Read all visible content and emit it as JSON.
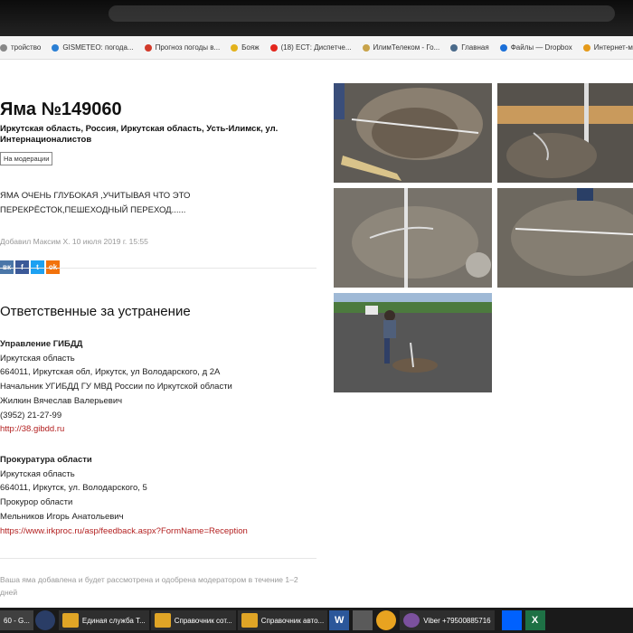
{
  "bookmarks": [
    {
      "label": "тройство",
      "color": "#888888"
    },
    {
      "label": "GISMETEO: погода...",
      "color": "#2a7fd4"
    },
    {
      "label": "Прогноз погоды в...",
      "color": "#d23a2a"
    },
    {
      "label": "Бояж",
      "color": "#e3b21c"
    },
    {
      "label": "(18) ЕСТ: Диспетче...",
      "color": "#e3261c"
    },
    {
      "label": "ИлимТелеком - Го...",
      "color": "#c8a34a"
    },
    {
      "label": "Главная",
      "color": "#4a6a8a"
    },
    {
      "label": "Файлы — Dropbox",
      "color": "#1a6fd8"
    },
    {
      "label": "Интернет-магаз...",
      "color": "#e59a1a"
    }
  ],
  "page": {
    "title": "Яма №149060",
    "address": "Иркутская область, Россия, Иркутская область, Усть-Илимск, ул. Интернационалистов",
    "status": "На модерации",
    "description": "ЯМА ОЧЕНЬ ГЛУБОКАЯ ,УЧИТЫВАЯ ЧТО ЭТО ПЕРЕКРЁСТОК,ПЕШЕХОДНЫЙ ПЕРЕХОД......",
    "added_by": "Добавил Максим Х. 10 июля 2019 г. 15:55",
    "share": [
      {
        "label": "вк",
        "color": "#4a76a8"
      },
      {
        "label": "f",
        "color": "#3b5998"
      },
      {
        "label": "t",
        "color": "#1da1f2"
      },
      {
        "label": "ok",
        "color": "#f2720c"
      }
    ],
    "responsible_title": "Ответственные за устранение",
    "orgs": [
      {
        "name": "Управление ГИБДД",
        "region": "Иркутская область",
        "address": "664011, Иркутская обл, Иркутск, ул Володарского, д 2А",
        "position": "Начальник УГИБДД ГУ МВД России по Иркутской области",
        "person": "Жилкин Вячеслав Валерьевич",
        "phone": "(3952) 21-27-99",
        "link": "http://38.gibdd.ru"
      },
      {
        "name": "Прокуратура области",
        "region": "Иркутская область",
        "address": "664011, Иркутск, ул. Володарского, 5",
        "position": "Прокурор области",
        "person": "Мельников Игорь Анатольевич",
        "link": "https://www.irkproc.ru/asp/feedback.aspx?FormName=Reception"
      }
    ],
    "footer": "Ваша яма добавлена и будет рассмотрена и одобрена модератором в течение 1–2 дней"
  },
  "taskbar": {
    "left_label": "60 - G...",
    "items": [
      "Единая служба Т...",
      "Справочник сот...",
      "Справочник авто..."
    ],
    "viber": "Viber +79500885716"
  }
}
